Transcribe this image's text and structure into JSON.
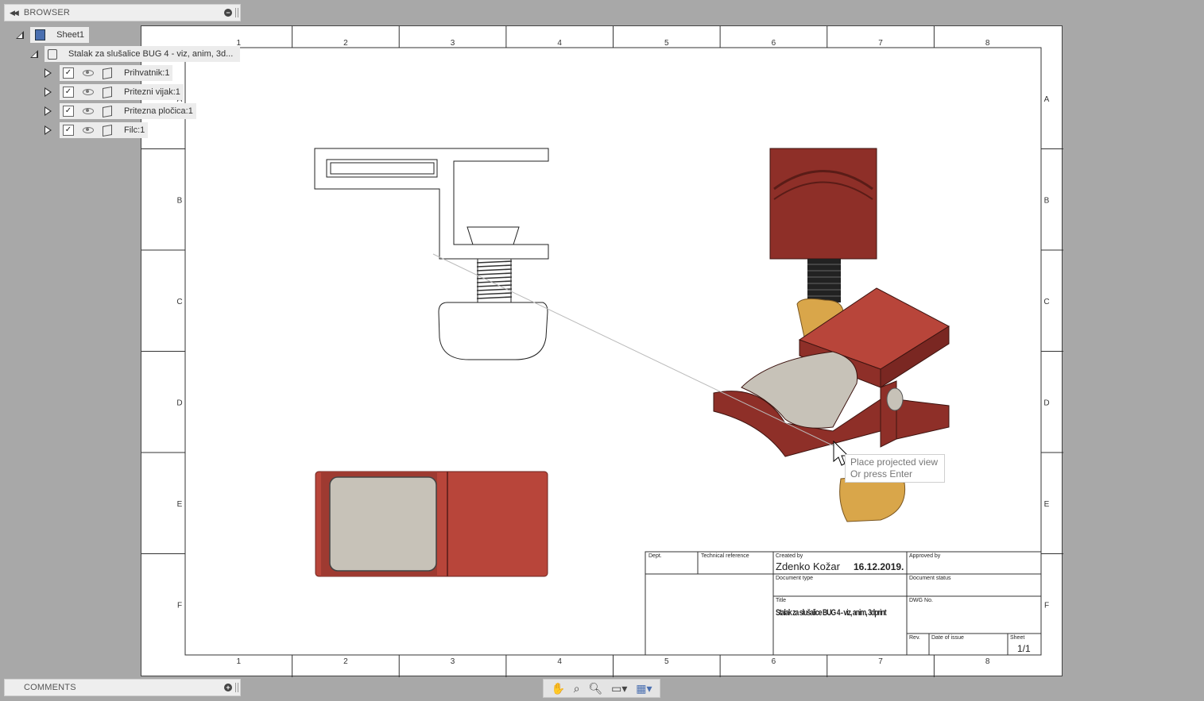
{
  "browser": {
    "title": "BROWSER",
    "sheet_label": "Sheet1",
    "document_label": "Stalak za slušalice BUG 4 - viz, anim, 3d...",
    "components": [
      {
        "label": "Prihvatnik:1"
      },
      {
        "label": "Pritezni vijak:1"
      },
      {
        "label": "Pritezna pločica:1"
      },
      {
        "label": "Filc:1"
      }
    ]
  },
  "comments": {
    "title": "COMMENTS"
  },
  "drawing": {
    "columns": [
      "1",
      "2",
      "3",
      "4",
      "5",
      "6",
      "7",
      "8"
    ],
    "rows": [
      "A",
      "B",
      "C",
      "D",
      "E",
      "F"
    ],
    "colors": {
      "part_red": "#b8453a",
      "part_dark_red": "#8e2f28",
      "felt_grey": "#c7c2b8",
      "brass": "#d9a64a"
    }
  },
  "title_block": {
    "dept_label": "Dept.",
    "technical_reference_label": "Technical reference",
    "created_by_label": "Created by",
    "created_by_value": "Zdenko Kožar",
    "date_value": "16.12.2019.",
    "approved_by_label": "Approved by",
    "document_type_label": "Document type",
    "document_status_label": "Document status",
    "title_label": "Title",
    "title_value": "Stalak za slušalice BUG 4 - viz, anim, 3dprint",
    "dwg_no_label": "DWG No.",
    "rev_label": "Rev.",
    "date_of_issue_label": "Date of issue",
    "sheet_label": "Sheet",
    "sheet_value": "1/1"
  },
  "tooltip": {
    "line1": "Place projected view",
    "line2": "Or press Enter"
  },
  "toolbar": {
    "icons": [
      "pan-icon",
      "zoom-window-icon",
      "zoom-icon",
      "display-settings-icon",
      "grid-icon"
    ]
  }
}
